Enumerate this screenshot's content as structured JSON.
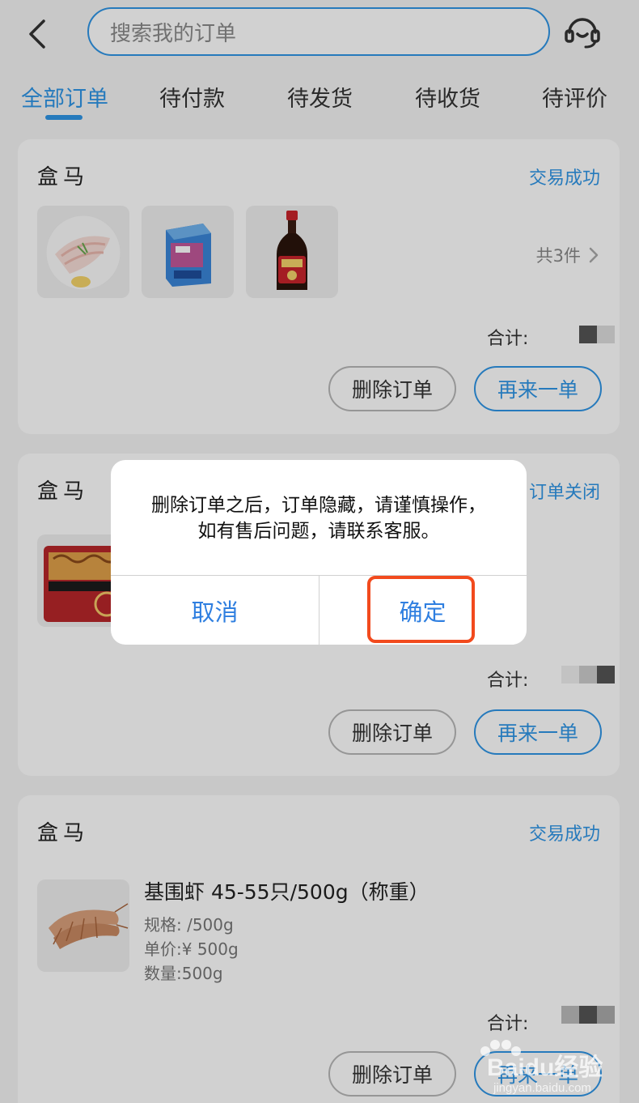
{
  "header": {
    "search_placeholder": "搜索我的订单"
  },
  "tabs": [
    {
      "label": "全部订单",
      "active": true
    },
    {
      "label": "待付款",
      "active": false
    },
    {
      "label": "待发货",
      "active": false
    },
    {
      "label": "待收货",
      "active": false
    },
    {
      "label": "待评价",
      "active": false
    }
  ],
  "orders": [
    {
      "shop": "盒马",
      "status": "交易成功",
      "count_label": "共3件",
      "total_label": "合计:",
      "delete_label": "删除订单",
      "reorder_label": "再来一单"
    },
    {
      "shop": "盒马",
      "status": "订单关闭",
      "total_label": "合计:",
      "delete_label": "删除订单",
      "reorder_label": "再来一单"
    },
    {
      "shop": "盒马",
      "status": "交易成功",
      "item_title": "基围虾 45-55只/500g（称重）",
      "item_spec": "规格:          /500g",
      "item_price": "单价:¥        500g",
      "item_qty": "数量:500g",
      "total_label": "合计:",
      "delete_label": "删除订单",
      "reorder_label": "再来一单"
    }
  ],
  "dialog": {
    "message": "删除订单之后，订单隐藏，请谨慎操作，如有售后问题，请联系客服。",
    "cancel_label": "取消",
    "confirm_label": "确定"
  },
  "watermark": {
    "brand": "Baidu经验",
    "url": "jingyan.baidu.com"
  },
  "colors": {
    "accent": "#2f95e6",
    "highlight": "#f24a1d"
  }
}
